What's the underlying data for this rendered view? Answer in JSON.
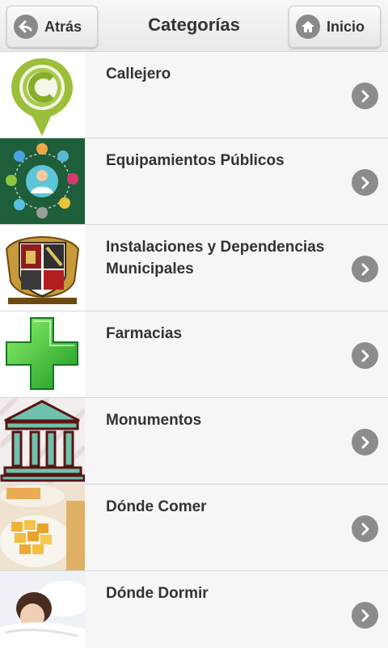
{
  "header": {
    "back_label": "Atrás",
    "title": "Categorías",
    "home_label": "Inicio",
    "back_icon": "back-arrow-icon",
    "home_icon": "house-icon"
  },
  "categories": [
    {
      "label": "Callejero",
      "image": "street-map-pin-logo"
    },
    {
      "label": "Equipamientos Públicos",
      "image": "public-services-icons"
    },
    {
      "label": "Instalaciones y Dependencias Municipales",
      "image": "municipal-coat-of-arms"
    },
    {
      "label": "Farmacias",
      "image": "green-pharmacy-cross"
    },
    {
      "label": "Monumentos",
      "image": "monument-temple"
    },
    {
      "label": "Dónde Comer",
      "image": "food-and-beer-photo"
    },
    {
      "label": "Dónde Dormir",
      "image": "sleeping-woman-photo"
    }
  ],
  "colors": {
    "header_bg": "#eeeeee",
    "row_bg": "#f6f6f6",
    "text": "#333333",
    "chevron": "#8c8c8c"
  }
}
